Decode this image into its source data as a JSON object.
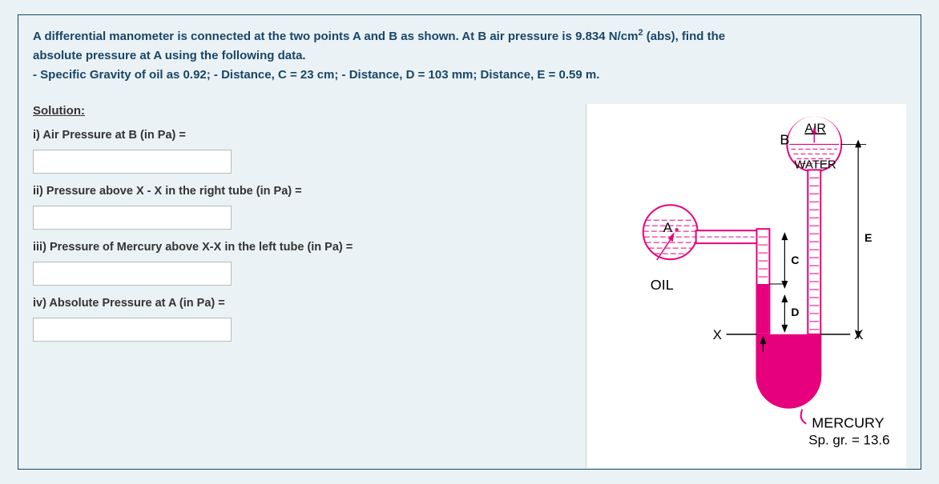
{
  "problem": {
    "line1": "A differential manometer is connected at the two points A and B as shown. At B air pressure is 9.834 N/cm",
    "sup1": "2",
    "line1b": " (abs), find the",
    "line2": "absolute pressure at A using the following data.",
    "line3": "- Specific Gravity of oil as 0.92;  - Distance, C = 23 cm;   - Distance, D = 103 mm; Distance, E = 0.59 m."
  },
  "solution": {
    "heading": "Solution:",
    "q1": "i) Air Pressure at B (in Pa) =",
    "q2": "ii) Pressure above X - X in the right tube (in Pa) =",
    "q3": "iii) Pressure of Mercury above X-X in the left tube (in Pa) =",
    "q4": "iv) Absolute Pressure at A (in Pa) ="
  },
  "diagram": {
    "air": "AIR",
    "water": "WATER",
    "oil": "OIL",
    "mercury": "MERCURY",
    "spgr": "Sp. gr. = 13.6",
    "A": "A",
    "B": "B",
    "C": "C",
    "D": "D",
    "E": "E",
    "X": "X"
  }
}
